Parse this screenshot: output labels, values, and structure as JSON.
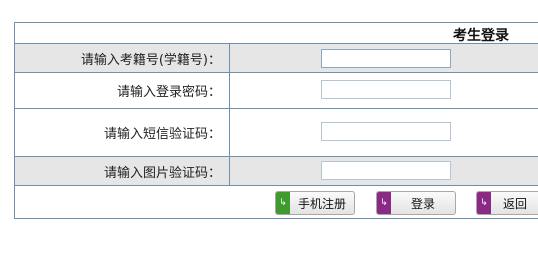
{
  "panel": {
    "title": "考生登录"
  },
  "fields": [
    {
      "label": "请输入考籍号(学籍号)：",
      "value": "",
      "placeholder": ""
    },
    {
      "label": "请输入登录密码：",
      "value": "",
      "placeholder": ""
    },
    {
      "label": "请输入短信验证码：",
      "value": "",
      "placeholder": ""
    },
    {
      "label": "请输入图片验证码：",
      "value": "",
      "placeholder": ""
    }
  ],
  "buttons": {
    "register": "手机注册",
    "login": "登录",
    "back": "返回"
  },
  "icons": {
    "register": "arrow-return-icon",
    "login": "arrow-return-icon",
    "back": "arrow-return-icon"
  },
  "colors": {
    "border": "#6f8fb2",
    "shade": "#e6e6e6",
    "register_tag": "#3f9b2d",
    "login_tag": "#8b2a85",
    "back_tag": "#8b2a85"
  }
}
